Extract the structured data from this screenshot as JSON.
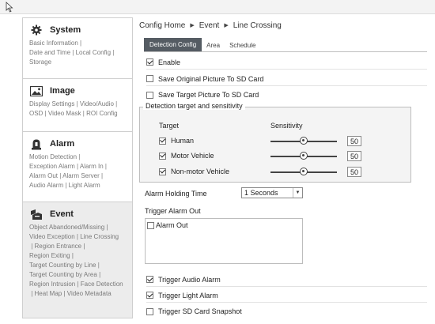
{
  "sidebar": {
    "sections": [
      {
        "title": "System",
        "icon": "gear-icon",
        "links": [
          "Basic Information",
          "Date and Time",
          "Local Config",
          "Storage"
        ]
      },
      {
        "title": "Image",
        "icon": "image-icon",
        "links": [
          "Display Settings",
          "Video/Audio",
          "OSD",
          "Video Mask",
          "ROI Config"
        ]
      },
      {
        "title": "Alarm",
        "icon": "alarm-icon",
        "links": [
          "Motion Detection",
          "Exception Alarm",
          "Alarm In",
          "Alarm Out",
          "Alarm Server",
          "Audio Alarm",
          "Light Alarm"
        ]
      },
      {
        "title": "Event",
        "icon": "event-icon",
        "links": [
          "Object Abandoned/Missing",
          "Video Exception",
          "Line Crossing",
          "Region Entrance",
          "Region Exiting",
          "Target Counting by Line",
          "Target Counting by Area",
          "Region Intrusion",
          "Face Detection",
          "Heat Map",
          "Video Metadata"
        ]
      }
    ]
  },
  "breadcrumb": [
    "Config Home",
    "Event",
    "Line Crossing"
  ],
  "tabs": [
    "Detection Config",
    "Area",
    "Schedule"
  ],
  "active_tab": "Detection Config",
  "options": {
    "enable": {
      "label": "Enable",
      "checked": true
    },
    "save_original": {
      "label": "Save Original Picture To SD Card",
      "checked": false
    },
    "save_target": {
      "label": "Save Target Picture To SD Card",
      "checked": false
    }
  },
  "detection": {
    "legend": "Detection target and sensitivity",
    "col_target": "Target",
    "col_sensitivity": "Sensitivity",
    "targets": [
      {
        "label": "Human",
        "checked": true,
        "value": "50",
        "fraction": 0.5
      },
      {
        "label": "Motor Vehicle",
        "checked": true,
        "value": "50",
        "fraction": 0.5
      },
      {
        "label": "Non-motor Vehicle",
        "checked": true,
        "value": "50",
        "fraction": 0.5
      }
    ]
  },
  "holding": {
    "label": "Alarm Holding Time",
    "value": "1 Seconds"
  },
  "trigger_out": {
    "label": "Trigger Alarm Out",
    "item": "Alarm Out",
    "checked": false
  },
  "triggers": {
    "audio": {
      "label": "Trigger Audio Alarm",
      "checked": true
    },
    "light": {
      "label": "Trigger Light Alarm",
      "checked": true
    },
    "sd_snapshot": {
      "label": "Trigger SD Card Snapshot",
      "checked": false
    }
  }
}
